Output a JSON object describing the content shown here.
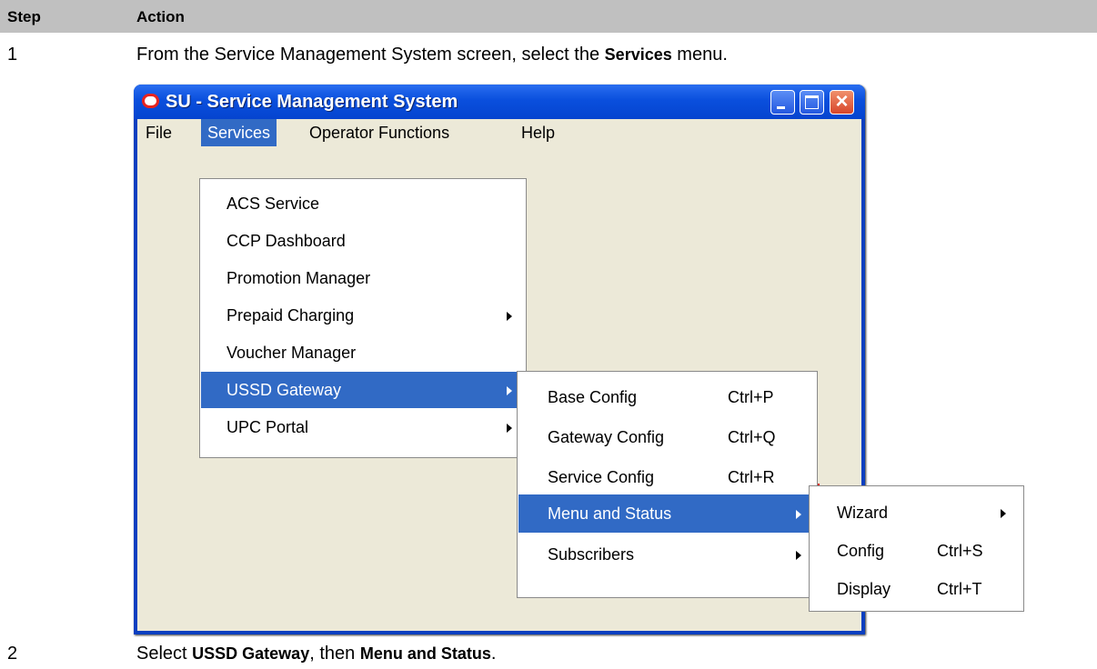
{
  "doc": {
    "header": {
      "step": "Step",
      "action": "Action"
    },
    "step1": {
      "number": "1",
      "text_before": "From the Service Management System screen, select the ",
      "bold": "Services",
      "text_after": " menu."
    },
    "step2": {
      "number": "2",
      "text_before": "Select ",
      "bold1": "USSD Gateway",
      "text_mid": ", then ",
      "bold2": "Menu and Status",
      "text_after": "."
    }
  },
  "window": {
    "title": "SU - Service Management System",
    "menubar": [
      "File",
      "Services",
      "Operator Functions",
      "Help"
    ]
  },
  "services_menu": [
    {
      "label": "ACS Service"
    },
    {
      "label": "CCP Dashboard"
    },
    {
      "label": "Promotion Manager"
    },
    {
      "label": "Prepaid Charging"
    },
    {
      "label": "Voucher Manager"
    },
    {
      "label": "USSD Gateway"
    },
    {
      "label": "UPC Portal"
    }
  ],
  "ussd_menu": [
    {
      "label": "Base Config",
      "shortcut": "Ctrl+P"
    },
    {
      "label": "Gateway Config",
      "shortcut": "Ctrl+Q"
    },
    {
      "label": "Service Config",
      "shortcut": "Ctrl+R"
    },
    {
      "label": "Menu and Status",
      "shortcut": ""
    },
    {
      "label": "Subscribers",
      "shortcut": ""
    }
  ],
  "status_menu": [
    {
      "label": "Wizard",
      "shortcut": ""
    },
    {
      "label": "Config",
      "shortcut": "Ctrl+S"
    },
    {
      "label": "Display",
      "shortcut": "Ctrl+T"
    }
  ],
  "colors": {
    "menu_highlight": "#316ac5",
    "title_bar": "#0a4fdd",
    "window_bg": "#ece9d8",
    "header_bg": "#c0c0c0"
  }
}
